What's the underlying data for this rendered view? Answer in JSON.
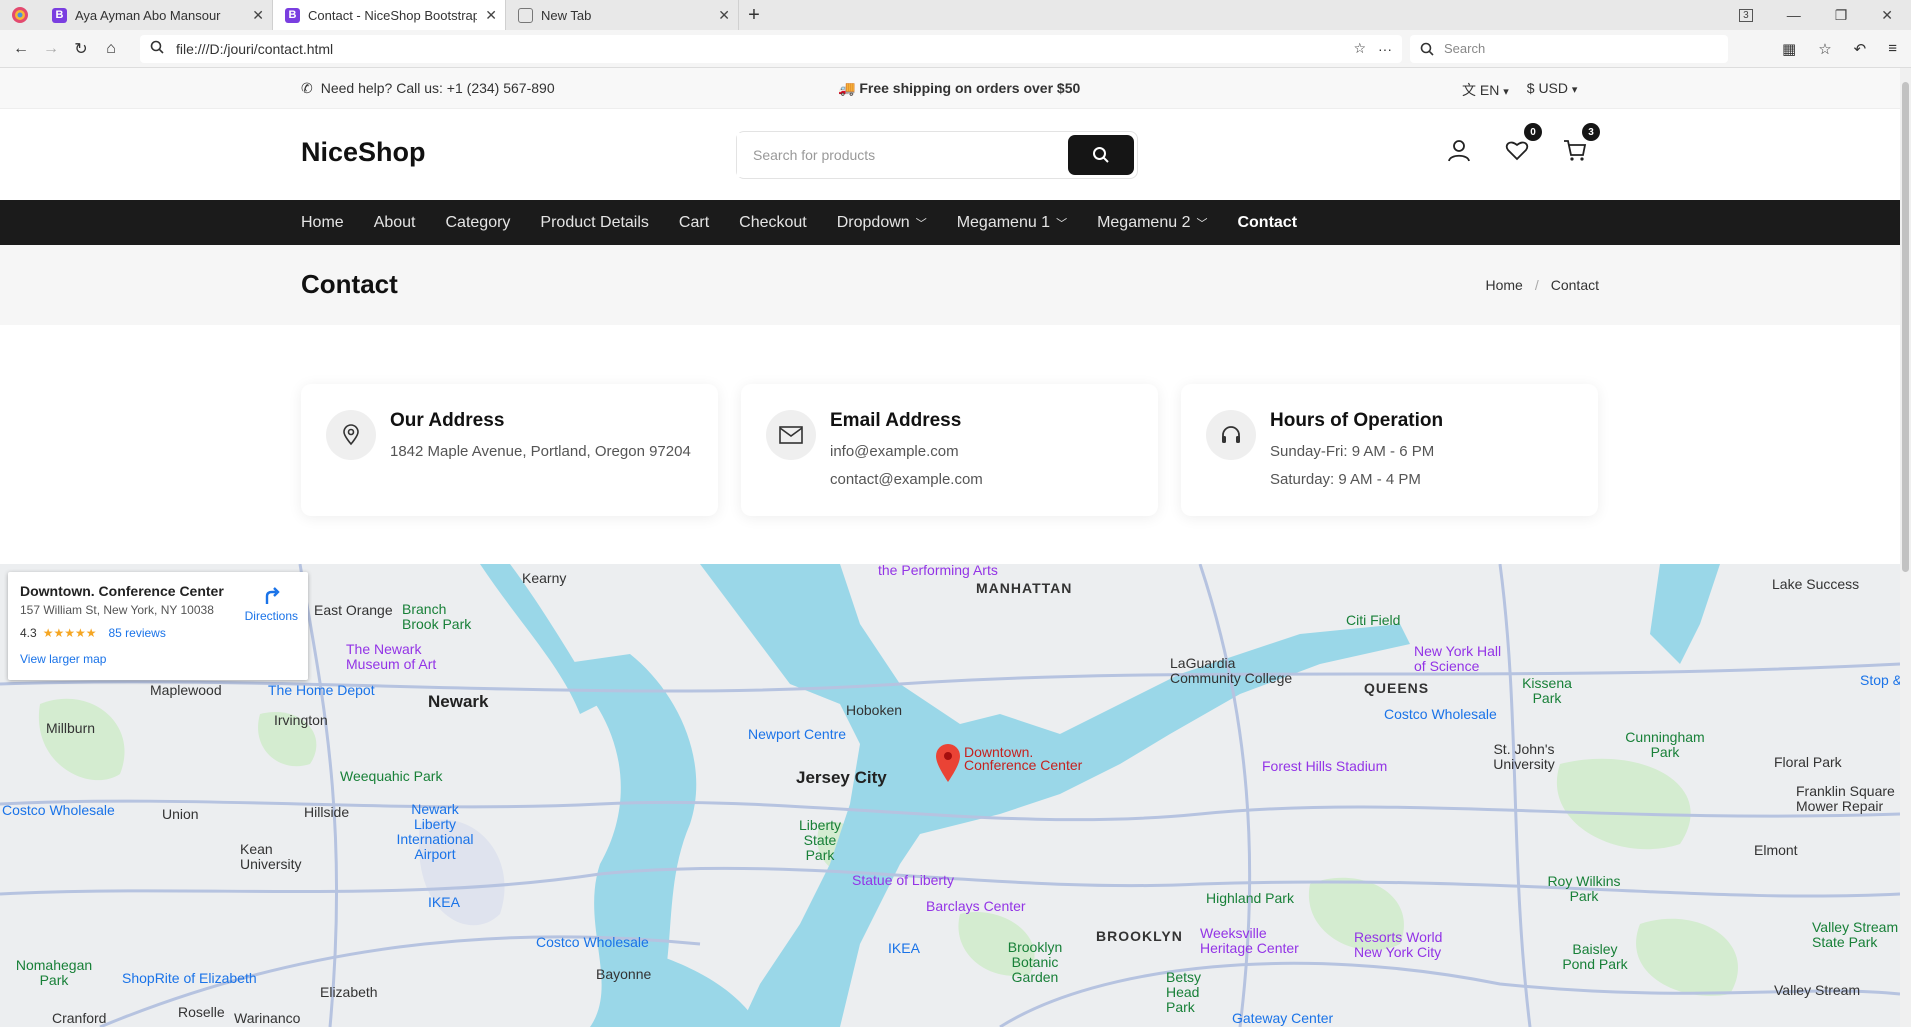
{
  "browser": {
    "tabs": [
      {
        "title": "Aya Ayman Abo Mansour",
        "icon": "bootstrap-icon"
      },
      {
        "title": "Contact - NiceShop Bootstrap",
        "icon": "bootstrap-icon"
      },
      {
        "title": "New Tab",
        "icon": "page-icon"
      }
    ],
    "url": "file:///D:/jouri/contact.html",
    "search_placeholder": "Search",
    "tab_count": "3"
  },
  "topbar": {
    "help": "Need help? Call us: +1 (234) 567-890",
    "shipping": "🚚 Free shipping on orders over $50",
    "language": "EN",
    "currency": "$  USD"
  },
  "header": {
    "logo": "NiceShop",
    "search_placeholder": "Search for products",
    "wishlist_count": "0",
    "cart_count": "3"
  },
  "nav": {
    "items": [
      {
        "label": "Home"
      },
      {
        "label": "About"
      },
      {
        "label": "Category"
      },
      {
        "label": "Product Details"
      },
      {
        "label": "Cart"
      },
      {
        "label": "Checkout"
      },
      {
        "label": "Dropdown"
      },
      {
        "label": "Megamenu 1"
      },
      {
        "label": "Megamenu 2"
      },
      {
        "label": "Contact"
      }
    ]
  },
  "page": {
    "title": "Contact",
    "breadcrumb": [
      "Home",
      "Contact"
    ]
  },
  "cards": [
    {
      "title": "Our Address",
      "lines": [
        "1842 Maple Avenue, Portland, Oregon 97204"
      ],
      "icon": "map-pin-icon"
    },
    {
      "title": "Email Address",
      "lines": [
        "info@example.com",
        "contact@example.com"
      ],
      "icon": "envelope-icon"
    },
    {
      "title": "Hours of Operation",
      "lines": [
        "Sunday-Fri: 9 AM - 6 PM",
        "Saturday: 9 AM - 4 PM"
      ],
      "icon": "headphones-icon"
    }
  ],
  "map": {
    "place_name": "Downtown. Conference Center",
    "address": "157 William St, New York, NY 10038",
    "rating": "4.3",
    "stars": "★★★★★",
    "reviews": "85 reviews",
    "directions": "Directions",
    "larger_map": "View larger map",
    "marker_label_1": "Downtown.",
    "marker_label_2": "Conference Center",
    "labels": {
      "kearny": "Kearny",
      "east_orange": "East Orange",
      "branch_brook": "Branch Brook Park",
      "newark_museum": "The Newark Museum of Art",
      "newark": "Newark",
      "maplewood": "Maplewood",
      "home_depot": "The Home Depot",
      "irvington": "Irvington",
      "millburn": "Millburn",
      "union": "Union",
      "hillside": "Hillside",
      "weequahic": "Weequahic Park",
      "costco1": "Costco Wholesale",
      "newark_airport": "Newark Liberty International Airport",
      "ikea1": "IKEA",
      "kean": "Kean University",
      "nomahegan": "Nomahegan Park",
      "shoprite": "ShopRite of Elizabeth",
      "elizabeth": "Elizabeth",
      "roselle": "Roselle",
      "cranford": "Cranford",
      "warinanco": "Warinanco",
      "hoboken": "Hoboken",
      "newport": "Newport Centre",
      "jersey_city": "Jersey City",
      "liberty_park": "Liberty State Park",
      "statue": "Statue of Liberty",
      "costco2": "Costco Wholesale",
      "bayonne": "Bayonne",
      "manhattan": "MANHATTAN",
      "laguardia": "LaGuardia Community College",
      "citi_field": "Citi Field",
      "ny_hall": "New York Hall of Science",
      "queens": "QUEENS",
      "costco3": "Costco Wholesale",
      "forest_hills": "Forest Hills Stadium",
      "barclays": "Barclays Center",
      "ikea2": "IKEA",
      "brooklyn": "BROOKLYN",
      "botanic": "Brooklyn Botanic Garden",
      "highland": "Highland Park",
      "weeksville": "Weeksville Heritage Center",
      "resorts": "Resorts World New York City",
      "betsy": "Betsy Head Park",
      "gateway": "Gateway Center",
      "baisley": "Baisley Pond Park",
      "roy_wilkins": "Roy Wilkins Park",
      "st_johns": "St. John's University",
      "cunningham": "Cunningham Park",
      "floral_park": "Floral Park",
      "franklin": "Franklin Square Mower Repair",
      "elmont": "Elmont",
      "valley_stream": "Valley Stream",
      "valley_park": "Valley Stream State Park",
      "lake_success": "Lake Success",
      "kissena": "Kissena Park",
      "stop": "Stop &",
      "performing": "the Performing Arts"
    }
  }
}
